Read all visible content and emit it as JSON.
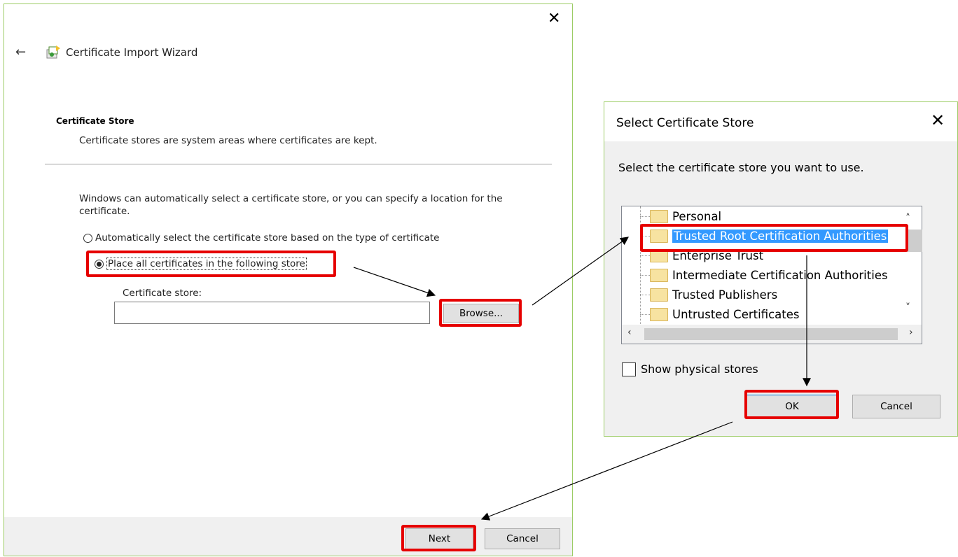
{
  "wizard": {
    "title": "Certificate Import Wizard",
    "section_title": "Certificate Store",
    "section_desc": "Certificate stores are system areas where certificates are kept.",
    "intro": "Windows can automatically select a certificate store, or you can specify a location for the certificate.",
    "radio_auto_label": "Automatically select the certificate store based on the type of certificate",
    "radio_auto_selected": false,
    "radio_place_label": "Place all certificates in the following store",
    "radio_place_selected": true,
    "store_label": "Certificate store:",
    "store_value": "",
    "browse_label": "Browse...",
    "next_label": "Next",
    "cancel_label": "Cancel"
  },
  "select_dialog": {
    "title": "Select Certificate Store",
    "prompt": "Select the certificate store you want to use.",
    "stores": [
      {
        "label": "Personal",
        "selected": false
      },
      {
        "label": "Trusted Root Certification Authorities",
        "selected": true
      },
      {
        "label": "Enterprise Trust",
        "selected": false
      },
      {
        "label": "Intermediate Certification Authorities",
        "selected": false
      },
      {
        "label": "Trusted Publishers",
        "selected": false
      },
      {
        "label": "Untrusted Certificates",
        "selected": false
      }
    ],
    "show_physical_label": "Show physical stores",
    "show_physical_checked": false,
    "ok_label": "OK",
    "cancel_label": "Cancel"
  },
  "colors": {
    "highlight": "#e60000",
    "selection": "#3399ff",
    "window_border": "#9ccc65"
  },
  "icons": [
    "close-icon",
    "back-arrow-icon",
    "certificate-wizard-icon",
    "folder-icon",
    "scroll-up-icon",
    "scroll-down-icon",
    "scroll-left-icon",
    "scroll-right-icon"
  ]
}
